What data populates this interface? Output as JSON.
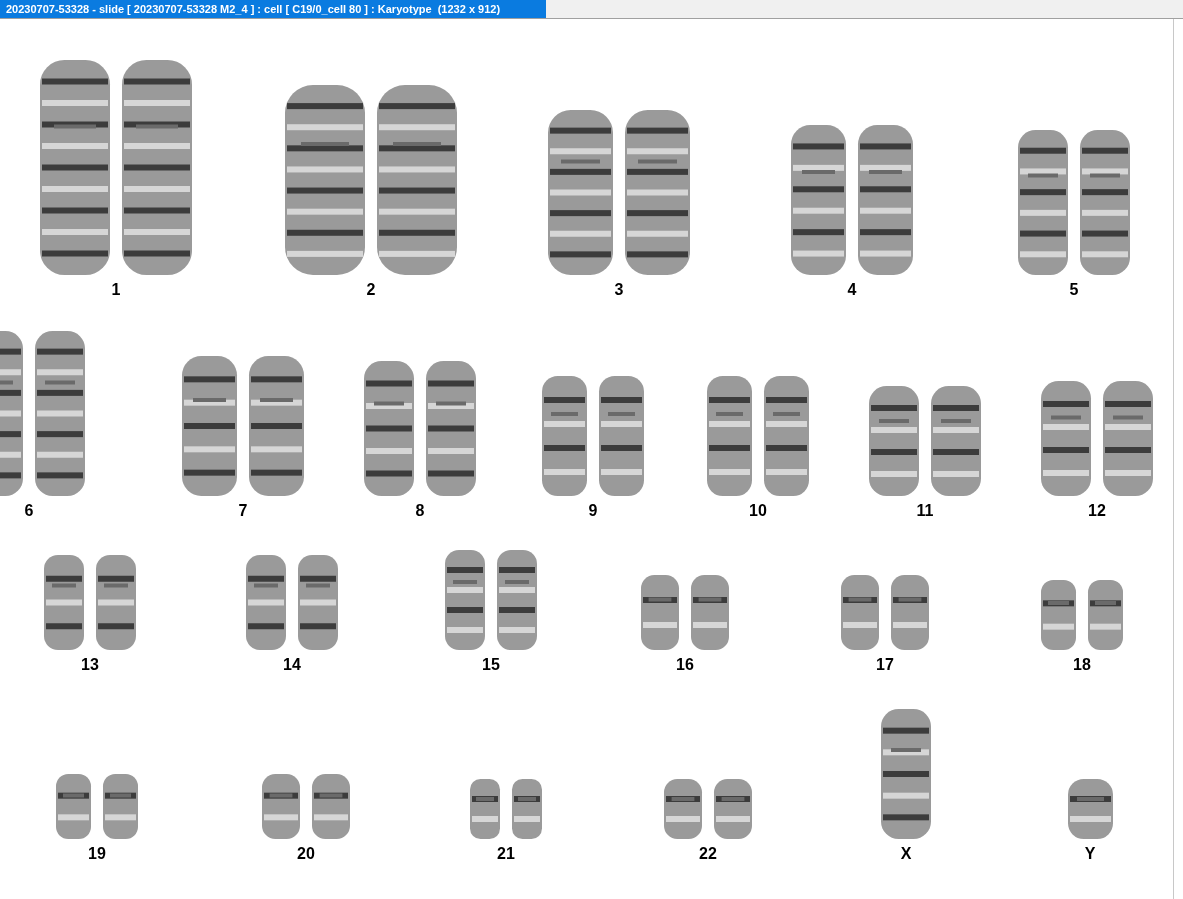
{
  "window": {
    "title": "20230707-53328 - slide [ 20230707-53328 M2_4 ] : cell [ C19/0_cell 80 ] : Karyotype  (1232 x 912)"
  },
  "karyotype": {
    "rows": [
      {
        "items": [
          {
            "label": "1",
            "kind": "pair"
          },
          {
            "label": "2",
            "kind": "pair"
          },
          {
            "label": "3",
            "kind": "pair"
          },
          {
            "label": "4",
            "kind": "pair"
          },
          {
            "label": "5",
            "kind": "pair"
          }
        ]
      },
      {
        "items": [
          {
            "label": "6",
            "kind": "pair"
          },
          {
            "label": "7",
            "kind": "pair"
          },
          {
            "label": "8",
            "kind": "pair"
          },
          {
            "label": "9",
            "kind": "pair"
          },
          {
            "label": "10",
            "kind": "pair"
          },
          {
            "label": "11",
            "kind": "pair"
          },
          {
            "label": "12",
            "kind": "pair"
          }
        ]
      },
      {
        "items": [
          {
            "label": "13",
            "kind": "pair"
          },
          {
            "label": "14",
            "kind": "pair"
          },
          {
            "label": "15",
            "kind": "pair"
          },
          {
            "label": "16",
            "kind": "pair"
          },
          {
            "label": "17",
            "kind": "pair"
          },
          {
            "label": "18",
            "kind": "pair"
          }
        ]
      },
      {
        "items": [
          {
            "label": "19",
            "kind": "pair"
          },
          {
            "label": "20",
            "kind": "pair"
          },
          {
            "label": "21",
            "kind": "pair"
          },
          {
            "label": "22",
            "kind": "pair"
          },
          {
            "label": "X",
            "kind": "single"
          },
          {
            "label": "Y",
            "kind": "single"
          }
        ]
      }
    ]
  }
}
